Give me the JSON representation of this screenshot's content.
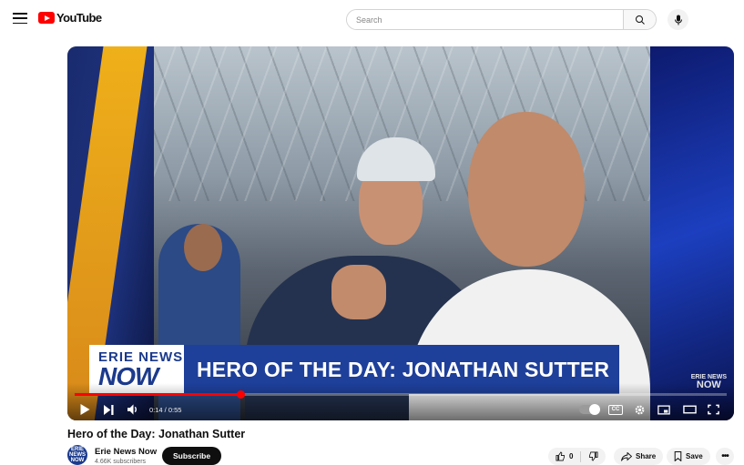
{
  "header": {
    "logo_text": "YouTube",
    "search_placeholder": "Search"
  },
  "video": {
    "lower_third": {
      "brand_line1": "ERIE NEWS",
      "brand_line2": "NOW",
      "headline": "HERO OF THE DAY: JONATHAN SUTTER"
    },
    "bug_line1": "ERIE NEWS",
    "bug_line2": "NOW",
    "time_display": "0:14 / 0:55",
    "progress_fraction": 0.2545,
    "captions_label": "CC"
  },
  "info": {
    "title": "Hero of the Day: Jonathan Sutter",
    "channel_name": "Erie News Now",
    "avatar_line1": "ERIE NEWS",
    "avatar_line2": "NOW",
    "subscribers": "4.66K subscribers",
    "subscribe_label": "Subscribe",
    "like_count": "0",
    "share_label": "Share",
    "save_label": "Save"
  },
  "colors": {
    "brand_red": "#ff0000",
    "news_blue": "#1e3f9a"
  }
}
